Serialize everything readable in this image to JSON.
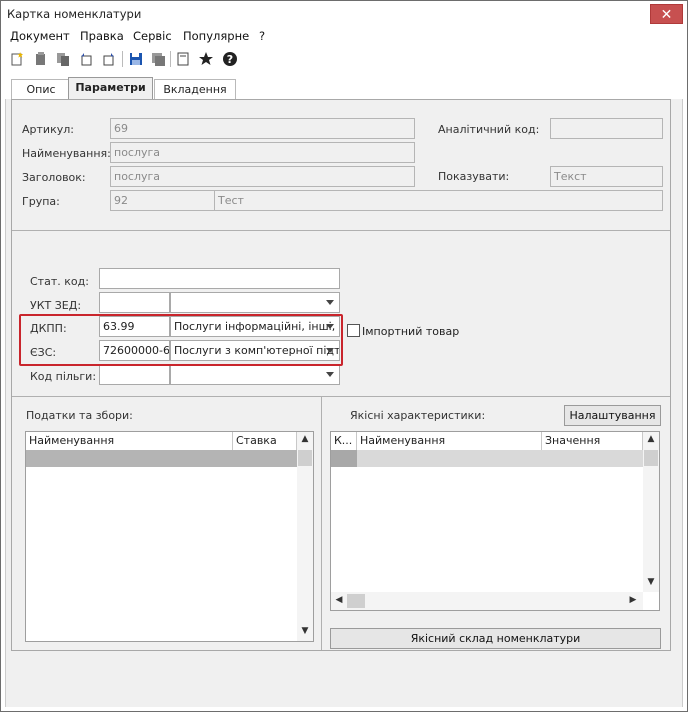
{
  "window": {
    "title": "Картка номенклатури",
    "close_glyph": "✕"
  },
  "menu": [
    "Документ",
    "Правка",
    "Сервіс",
    "Популярне",
    "?"
  ],
  "toolbar": {
    "icons": [
      "new-doc-icon",
      "copy-doc-icon",
      "copy-multi-icon",
      "undo-icon",
      "redo-icon",
      "save-icon",
      "save-disabled-icon",
      "page-icon",
      "star-icon",
      "help-icon"
    ]
  },
  "tabs": [
    "Опис",
    "Параметри",
    "Вкладення"
  ],
  "header": {
    "article_label": "Артикул:",
    "article_value": "69",
    "name_label": "Найменування:",
    "name_value": "послуга",
    "heading_label": "Заголовок:",
    "heading_value": "послуга",
    "group_label": "Група:",
    "group_code": "92",
    "group_name": "Тест",
    "analytic_label": "Аналітичний код:",
    "analytic_value": "",
    "show_label": "Показувати:",
    "show_value": "Текст"
  },
  "codes": {
    "stat_label": "Стат. код:",
    "stat_value": "",
    "ukt_label": "УКТ ЗЕД:",
    "ukt_code": "",
    "ukt_name": "",
    "dkpp_label": "ДКПП:",
    "dkpp_code": "63.99",
    "dkpp_name": "Послуги інформаційні, інші, н",
    "ezs_label": "ЄЗС:",
    "ezs_code": "72600000-6",
    "ezs_name": "Послуги з комп'ютерної підтр",
    "benefit_label": "Код пільги:",
    "benefit_code": "",
    "benefit_name": "",
    "import_label": "Імпортний товар"
  },
  "taxes": {
    "title": "Податки та збори:",
    "columns": [
      "Найменування",
      "Ставка"
    ]
  },
  "quality": {
    "title": "Якісні характеристики:",
    "settings_button": "Налаштування",
    "columns": [
      "К...",
      "Найменування",
      "Значення"
    ],
    "composition_button": "Якісний склад номенклатури"
  },
  "colors": {
    "highlight": "#c9252c",
    "close_red": "#c75050",
    "selected_row": "#b4b4b4"
  }
}
